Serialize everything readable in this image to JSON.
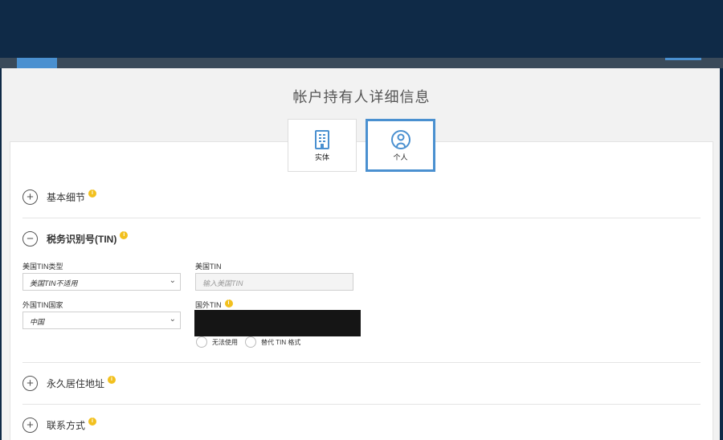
{
  "page": {
    "title": "帐户持有人详细信息"
  },
  "type_tabs": [
    {
      "label": "实体",
      "icon": "building-icon",
      "selected": false
    },
    {
      "label": "个人",
      "icon": "person-icon",
      "selected": true
    }
  ],
  "sections": {
    "basic": {
      "title": "基本细节",
      "toggle": "+",
      "info": "i"
    },
    "tin": {
      "title": "税务识别号(TIN)",
      "toggle": "−",
      "info": "i"
    },
    "residence": {
      "title": "永久居住地址",
      "toggle": "+",
      "info": "i"
    },
    "contact": {
      "title": "联系方式",
      "toggle": "+",
      "info": "i"
    }
  },
  "tin_form": {
    "us_tin_type_label": "美国TIN类型",
    "us_tin_type_value": "美国TIN不适用",
    "us_tin_label": "美国TIN",
    "us_tin_placeholder": "输入美国TIN",
    "foreign_country_label": "外国TIN国家",
    "foreign_country_value": "中国",
    "foreign_tin_label": "国外TIN",
    "options": [
      "无法使用",
      "替代 TIN 格式"
    ]
  },
  "colors": {
    "header": "#0f2a47",
    "accent": "#4a90d0",
    "info": "#f2c01e"
  }
}
